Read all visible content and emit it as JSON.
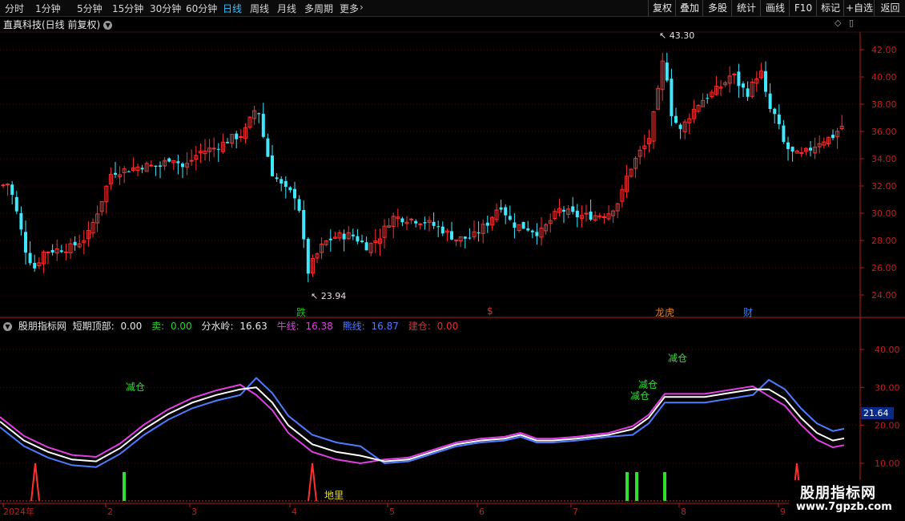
{
  "toolbar": {
    "periods": [
      "分时",
      "1分钟",
      "5分钟",
      "15分钟",
      "30分钟",
      "60分钟",
      "日线",
      "周线",
      "月线",
      "多周期",
      "更多"
    ],
    "active_period": "日线",
    "more_icon": "chevron-right-icon",
    "buttons": [
      "复权",
      "叠加",
      "多股",
      "统计",
      "画线",
      "F10",
      "标记",
      "+自选",
      "返回"
    ]
  },
  "stock": {
    "title": "直真科技(日线 前复权)",
    "dropdown_icon": "chevron-down-icon"
  },
  "main_chart": {
    "y_ticks": [
      "42.00",
      "40.00",
      "38.00",
      "36.00",
      "34.00",
      "32.00",
      "30.00",
      "28.00",
      "26.00",
      "24.00"
    ],
    "max_label": "43.30",
    "min_label": "23.94",
    "event_markers": [
      {
        "text": "跌",
        "color": "#20c020"
      },
      {
        "text": "$",
        "color": "#e03030"
      },
      {
        "text": "龙虎",
        "color": "#e08030"
      },
      {
        "text": "财",
        "color": "#3080ff"
      }
    ]
  },
  "indicator": {
    "name": "股朋指标网",
    "fields": [
      {
        "label": "短期顶部:",
        "value": "0.00",
        "color": "#e6e6e6"
      },
      {
        "label": "卖:",
        "value": "0.00",
        "color": "#30d030"
      },
      {
        "label": "分水岭:",
        "value": "16.63",
        "color": "#e6e6e6"
      },
      {
        "label": "牛线:",
        "value": "16.38",
        "color": "#e040e0"
      },
      {
        "label": "熊线:",
        "value": "16.87",
        "color": "#4d7cff"
      },
      {
        "label": "建仓:",
        "value": "0.00",
        "color": "#e03030"
      }
    ],
    "y_ticks": [
      "40.00",
      "30.00",
      "20.00",
      "10.00"
    ],
    "current_value": "21.64",
    "annotations": [
      "减仓",
      "减仓",
      "减仓",
      "减仓",
      "地里"
    ]
  },
  "x_axis": {
    "labels": [
      "2024年",
      "2",
      "3",
      "4",
      "5",
      "6",
      "7",
      "8",
      "9"
    ]
  },
  "watermark": {
    "line1": "股朋指标网",
    "line2": "www.7gpzb.com"
  }
}
